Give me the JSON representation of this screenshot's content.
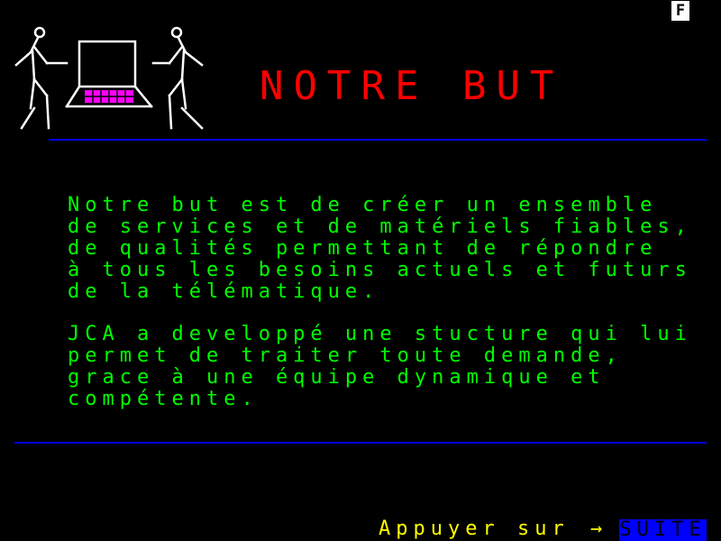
{
  "badge": "F",
  "header": {
    "title": "NOTRE BUT"
  },
  "content": {
    "paragraph1": "Notre but est de créer un ensemble\nde services et de matériels fiables,\nde qualités permettant de répondre\nà tous les besoins actuels et futurs\nde la télématique.",
    "paragraph2": "JCA a developpé une stucture qui lui\npermet de traiter toute demande,\ngrace à une équipe dynamique et\ncompétente."
  },
  "footer": {
    "prompt_label": "Appuyer sur",
    "arrow": "→",
    "suite_label": "SUITE"
  },
  "colors": {
    "background": "#000000",
    "title": "#ff0000",
    "text": "#00ff00",
    "rule": "#0000ee",
    "prompt": "#ffff00",
    "button": "#0000ff"
  },
  "icons": [
    "people-with-computer-logo"
  ]
}
